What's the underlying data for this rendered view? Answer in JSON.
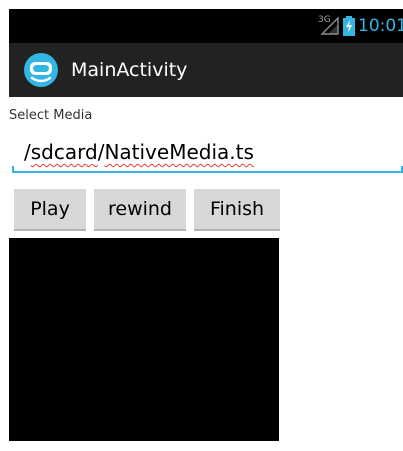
{
  "status_bar": {
    "network_label": "3G",
    "signal_icon": "signal-icon",
    "battery_icon": "battery-charging-icon",
    "time": "10:01",
    "time_color": "#33b5e5"
  },
  "action_bar": {
    "app_icon": "app-launcher-icon",
    "title": "MainActivity",
    "background": "#222222"
  },
  "form": {
    "label": "Select Media",
    "path_prefix": "/",
    "path_dir": "sdcard",
    "path_sep": "/",
    "path_file": "NativeMedia.ts",
    "accent": "#33b5e5"
  },
  "buttons": {
    "play": "Play",
    "rewind": "rewind",
    "finish": "Finish"
  },
  "video_surface": {
    "background": "#000000"
  }
}
